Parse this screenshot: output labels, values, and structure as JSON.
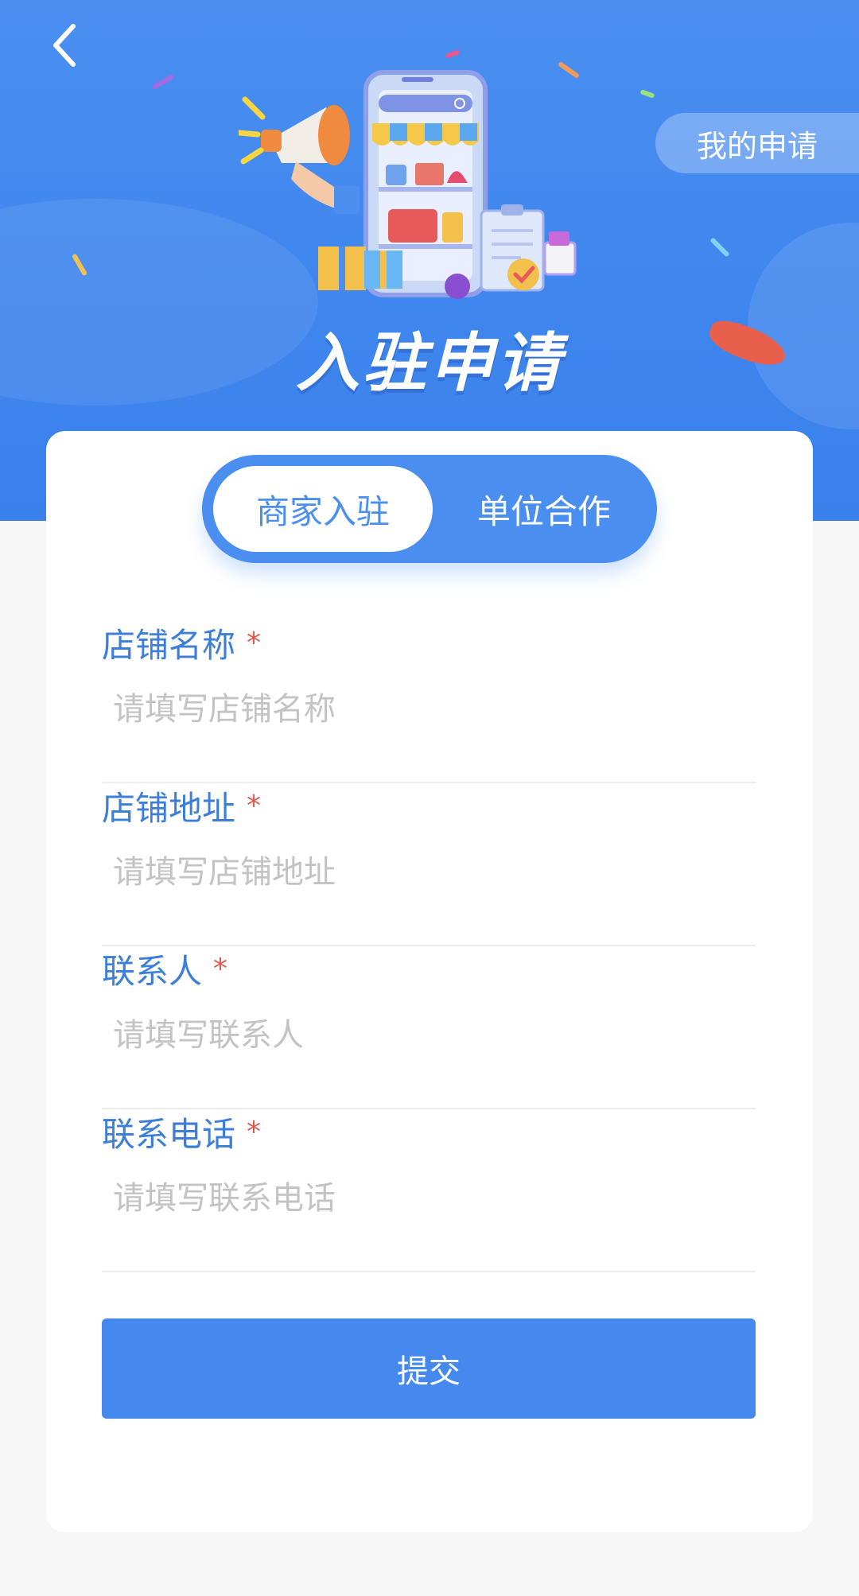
{
  "header": {
    "title": "入驻申请",
    "my_applications": "我的申请",
    "back_icon": "chevron-left-icon"
  },
  "tabs": [
    {
      "label": "商家入驻",
      "active": true
    },
    {
      "label": "单位合作",
      "active": false
    }
  ],
  "form": {
    "fields": [
      {
        "label": "店铺名称",
        "required_mark": "*",
        "placeholder": "请填写店铺名称",
        "value": ""
      },
      {
        "label": "店铺地址",
        "required_mark": "*",
        "placeholder": "请填写店铺地址",
        "value": ""
      },
      {
        "label": "联系人",
        "required_mark": "*",
        "placeholder": "请填写联系人",
        "value": ""
      },
      {
        "label": "联系电话",
        "required_mark": "*",
        "placeholder": "请填写联系电话",
        "value": ""
      }
    ],
    "submit_label": "提交"
  },
  "colors": {
    "primary": "#4a8ff0",
    "label": "#3d7fd8",
    "required": "#e05a4f",
    "placeholder": "#c3c3c3",
    "background": "#f7f7f8"
  }
}
